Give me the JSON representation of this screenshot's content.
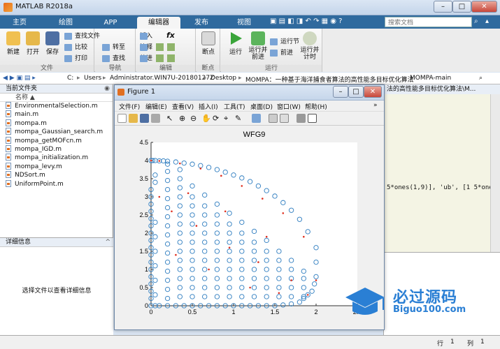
{
  "window": {
    "title": "MATLAB R2018a"
  },
  "ribbon_tabs": [
    "主页",
    "绘图",
    "APP",
    "编辑器",
    "发布",
    "视图"
  ],
  "active_tab": "编辑器",
  "search": {
    "placeholder": "搜索文档"
  },
  "ribbon": {
    "file": {
      "label": "文件",
      "new": "新建",
      "open": "打开",
      "save": "保存",
      "find_files": "查找文件",
      "compare": "比较",
      "print": "打印"
    },
    "navigate": {
      "label": "导航",
      "goto": "转至",
      "find": "查找"
    },
    "edit": {
      "label": "编辑",
      "insert": "插入",
      "fx": "fx",
      "comment": "注释",
      "indent": "缩进"
    },
    "breakpoints": {
      "label": "断点",
      "btn": "断点"
    },
    "run": {
      "label": "运行",
      "run": "运行",
      "run_advance": "运行并\n前进",
      "run_section": "运行节",
      "advance": "前进",
      "run_time": "运行并\n计时"
    }
  },
  "address": [
    "C:",
    "Users",
    "Administrator.WIN7U-20180127Z",
    "Desktop",
    "MOMPA：一种基于海洋捕食者算法的高性能多目标优化算法",
    "MOMPA-main"
  ],
  "current_folder": {
    "title": "当前文件夹",
    "column": "名称 ▲",
    "files": [
      "EnvironmentalSelection.m",
      "main.m",
      "mompa.m",
      "mompa_Gaussian_search.m",
      "mompa_getMOFcn.m",
      "mompa_IGD.m",
      "mompa_initialization.m",
      "mompa_levy.m",
      "NDSort.m",
      "UniformPoint.m"
    ]
  },
  "details": {
    "title": "详细信息",
    "message": "选择文件以查看详细信息"
  },
  "editor": {
    "tab": "法的高性能多目标优化算法\\M...",
    "code_fragment": "5*ones(1,9)], 'ub', [1 5*ones"
  },
  "figure": {
    "title": "Figure 1",
    "menu": [
      "文件(F)",
      "编辑(E)",
      "查看(V)",
      "插入(I)",
      "工具(T)",
      "桌面(D)",
      "窗口(W)",
      "帮助(H)"
    ]
  },
  "chart_data": {
    "type": "scatter",
    "title": "WFG9",
    "xlabel": "",
    "ylabel": "",
    "xlim": [
      0,
      2.5
    ],
    "ylim": [
      0,
      4.5
    ],
    "xticks": [
      "0",
      "0.5",
      "1",
      "1.5",
      "2",
      "2.5"
    ],
    "yticks": [
      "0",
      "0.5",
      "1",
      "1.5",
      "2",
      "2.5",
      "3",
      "3.5",
      "4",
      "4.5"
    ],
    "grid": false,
    "series": [
      {
        "marker": "circle",
        "color": "#2b7bbf",
        "x": [
          0,
          0.02,
          0.05,
          0.1,
          0.15,
          0.2,
          0.3,
          0.4,
          0.5,
          0.6,
          0.7,
          0.8,
          0.9,
          1.0,
          1.1,
          1.2,
          1.3,
          1.4,
          1.5,
          1.6,
          1.7,
          1.8,
          1.9,
          2.0,
          2.0,
          2.0,
          1.98,
          1.95,
          1.9,
          1.85,
          1.8,
          1.7,
          1.6,
          1.5,
          1.4,
          1.3,
          1.2,
          1.1,
          1.0,
          0.9,
          0.8,
          0.7,
          0.6,
          0.5,
          0.4,
          0.3,
          0.2,
          0.1,
          0.05,
          0,
          0,
          0,
          0,
          0,
          0,
          0,
          0,
          0,
          0,
          0,
          0,
          0,
          0,
          0,
          0,
          0,
          0.05,
          0.05,
          0.05,
          0.05,
          0.05,
          0.05,
          0.05,
          0.05,
          0.2,
          0.2,
          0.2,
          0.2,
          0.2,
          0.2,
          0.2,
          0.2,
          0.2,
          0.2,
          0.2,
          0.2,
          0.2,
          0.2,
          0.2,
          0.2,
          0.35,
          0.35,
          0.35,
          0.35,
          0.35,
          0.35,
          0.35,
          0.35,
          0.35,
          0.35,
          0.35,
          0.35,
          0.35,
          0.35,
          0.35,
          0.5,
          0.5,
          0.5,
          0.5,
          0.5,
          0.5,
          0.5,
          0.5,
          0.5,
          0.5,
          0.5,
          0.5,
          0.5,
          0.65,
          0.65,
          0.65,
          0.65,
          0.65,
          0.65,
          0.65,
          0.65,
          0.65,
          0.65,
          0.65,
          0.65,
          0.8,
          0.8,
          0.8,
          0.8,
          0.8,
          0.8,
          0.8,
          0.8,
          0.8,
          0.8,
          0.8,
          0.95,
          0.95,
          0.95,
          0.95,
          0.95,
          0.95,
          0.95,
          0.95,
          0.95,
          0.95,
          1.1,
          1.1,
          1.1,
          1.1,
          1.1,
          1.1,
          1.1,
          1.1,
          1.1,
          1.25,
          1.25,
          1.25,
          1.25,
          1.25,
          1.25,
          1.25,
          1.25,
          1.4,
          1.4,
          1.4,
          1.4,
          1.4,
          1.4,
          1.4,
          1.55,
          1.55,
          1.55,
          1.55,
          1.55,
          1.55,
          1.7,
          1.7,
          1.7,
          1.7,
          1.7,
          1.85,
          1.85,
          1.85,
          1.85
        ],
        "y": [
          4.0,
          4.0,
          4.0,
          3.99,
          3.99,
          3.98,
          3.96,
          3.93,
          3.9,
          3.86,
          3.81,
          3.75,
          3.68,
          3.6,
          3.52,
          3.42,
          3.3,
          3.17,
          3.02,
          2.84,
          2.63,
          2.38,
          2.04,
          1.6,
          1.2,
          0.8,
          0.6,
          0.4,
          0.3,
          0.2,
          0.1,
          0.05,
          0.02,
          0,
          0,
          0,
          0,
          0,
          0,
          0,
          0,
          0,
          0,
          0,
          0,
          0,
          0,
          0,
          0,
          0,
          0.2,
          0.4,
          0.6,
          0.8,
          1.0,
          1.2,
          1.4,
          1.6,
          1.8,
          2.0,
          2.2,
          2.4,
          2.6,
          2.8,
          3.0,
          3.2,
          3.4,
          3.6,
          0.3,
          0.7,
          1.1,
          1.5,
          1.9,
          2.3,
          0.2,
          0.45,
          0.7,
          0.95,
          1.2,
          1.45,
          1.7,
          1.95,
          2.2,
          2.45,
          2.7,
          2.95,
          3.2,
          3.45,
          3.7,
          3.9,
          0.25,
          0.5,
          0.75,
          1.0,
          1.25,
          1.5,
          1.75,
          2.0,
          2.25,
          2.5,
          2.75,
          3.0,
          3.25,
          3.5,
          3.75,
          0.25,
          0.5,
          0.75,
          1.0,
          1.25,
          1.5,
          1.75,
          2.0,
          2.25,
          2.5,
          2.75,
          3.0,
          3.3,
          0.25,
          0.5,
          0.75,
          1.0,
          1.25,
          1.5,
          1.75,
          2.0,
          2.25,
          2.5,
          2.75,
          3.05,
          0.25,
          0.5,
          0.75,
          1.0,
          1.25,
          1.5,
          1.75,
          2.0,
          2.25,
          2.5,
          2.8,
          0.25,
          0.5,
          0.75,
          1.0,
          1.25,
          1.5,
          1.75,
          2.0,
          2.25,
          2.55,
          0.25,
          0.5,
          0.75,
          1.0,
          1.25,
          1.5,
          1.75,
          2.0,
          2.3,
          0.25,
          0.5,
          0.75,
          1.0,
          1.25,
          1.5,
          1.75,
          2.05,
          0.25,
          0.5,
          0.75,
          1.0,
          1.25,
          1.5,
          1.8,
          0.25,
          0.5,
          0.75,
          1.0,
          1.25,
          1.5,
          0.25,
          0.5,
          0.75,
          1.0,
          1.25,
          0.25,
          0.5,
          0.75,
          0.95
        ]
      },
      {
        "marker": "dot",
        "color": "#e03020",
        "x": [
          0,
          0.1,
          0.35,
          0.6,
          0.85,
          1.1,
          1.35,
          1.6,
          1.85,
          2.0,
          0.25,
          0.55,
          0.95,
          1.3,
          1.7,
          0.45,
          0.9,
          1.4,
          0.7,
          1.2,
          1.9,
          0.1,
          0.3,
          1.55
        ],
        "y": [
          4.0,
          3.99,
          3.92,
          3.78,
          3.58,
          3.3,
          2.95,
          2.55,
          1.9,
          0.7,
          2.6,
          2.2,
          1.6,
          1.2,
          0.7,
          3.1,
          2.6,
          1.9,
          1.0,
          0.5,
          0.3,
          3.0,
          1.4,
          0.35
        ]
      }
    ]
  },
  "status": {
    "row_label": "行",
    "row": "1",
    "col_label": "列",
    "col": "1"
  },
  "watermark": {
    "cn": "必过源码",
    "url": "Biguo100.com"
  }
}
